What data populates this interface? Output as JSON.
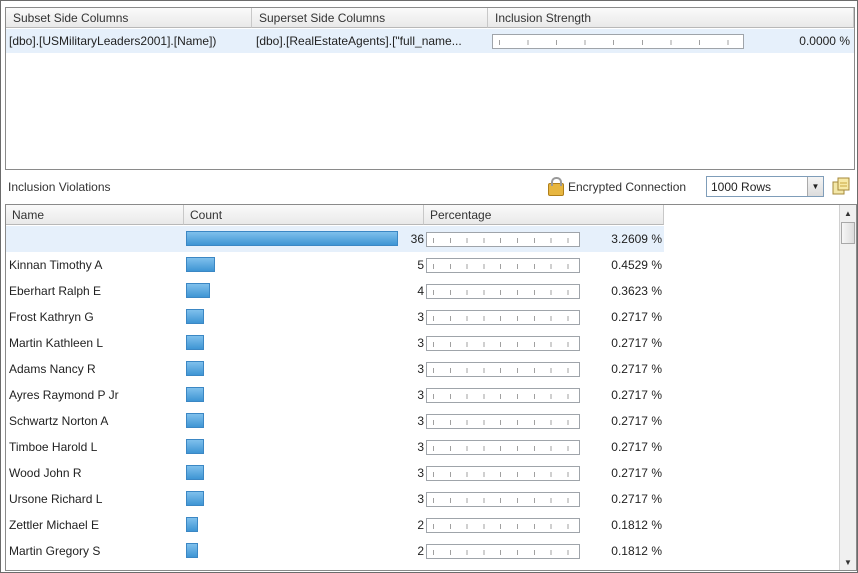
{
  "top_grid": {
    "columns": [
      "Subset Side Columns",
      "Superset Side Columns",
      "Inclusion Strength"
    ],
    "row": {
      "subset": "[dbo].[USMilitaryLeaders2001].[Name])",
      "superset": "[dbo].[RealEstateAgents].[\"full_name...",
      "strength": "0.0000 %"
    }
  },
  "violations": {
    "label": "Inclusion Violations",
    "encrypted_label": "Encrypted Connection",
    "rows_select": "1000 Rows"
  },
  "bottom_grid": {
    "columns": [
      "Name",
      "Count",
      "Percentage"
    ],
    "max_count": 36,
    "rows": [
      {
        "name": "",
        "count": "36",
        "count_value": 36,
        "percent": "3.2609 %",
        "selected": true
      },
      {
        "name": "Kinnan Timothy A",
        "count": "5",
        "count_value": 5,
        "percent": "0.4529 %"
      },
      {
        "name": "Eberhart Ralph E",
        "count": "4",
        "count_value": 4,
        "percent": "0.3623 %"
      },
      {
        "name": "Frost Kathryn G",
        "count": "3",
        "count_value": 3,
        "percent": "0.2717 %"
      },
      {
        "name": "Martin Kathleen L",
        "count": "3",
        "count_value": 3,
        "percent": "0.2717 %"
      },
      {
        "name": "Adams Nancy R",
        "count": "3",
        "count_value": 3,
        "percent": "0.2717 %"
      },
      {
        "name": "Ayres Raymond P Jr",
        "count": "3",
        "count_value": 3,
        "percent": "0.2717 %"
      },
      {
        "name": "Schwartz Norton A",
        "count": "3",
        "count_value": 3,
        "percent": "0.2717 %"
      },
      {
        "name": "Timboe Harold L",
        "count": "3",
        "count_value": 3,
        "percent": "0.2717 %"
      },
      {
        "name": "Wood John R",
        "count": "3",
        "count_value": 3,
        "percent": "0.2717 %"
      },
      {
        "name": "Ursone Richard L",
        "count": "3",
        "count_value": 3,
        "percent": "0.2717 %"
      },
      {
        "name": "Zettler Michael E",
        "count": "2",
        "count_value": 2,
        "percent": "0.1812 %"
      },
      {
        "name": "Martin Gregory S",
        "count": "2",
        "count_value": 2,
        "percent": "0.1812 %"
      }
    ]
  },
  "icons": {
    "lock": "lock-icon",
    "refresh": "refresh-icon",
    "dropdown": "chevron-down-icon",
    "scroll_up": "scroll-up-arrow-icon",
    "scroll_down": "scroll-down-arrow-icon"
  }
}
